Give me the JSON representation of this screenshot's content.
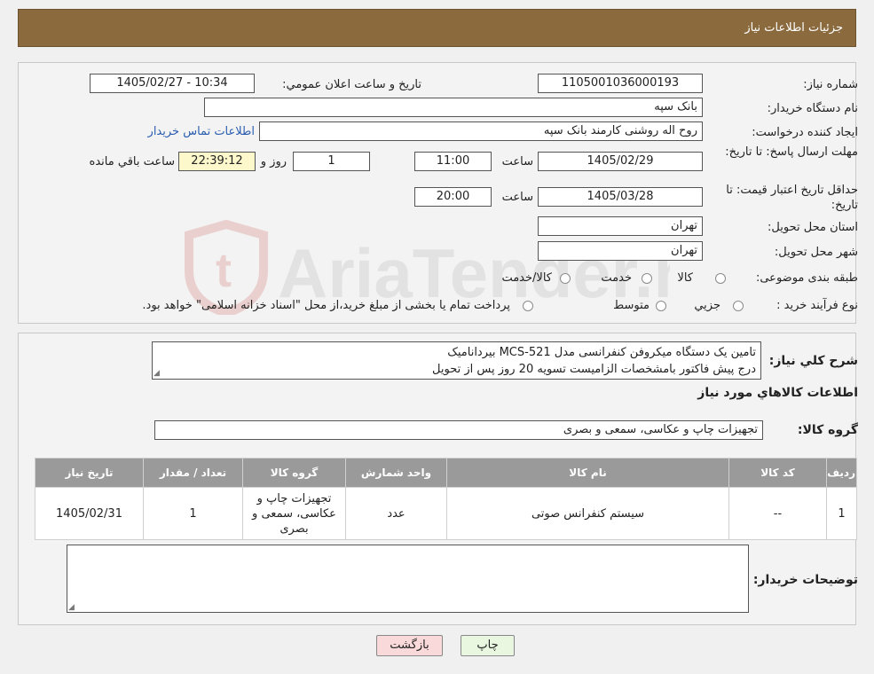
{
  "header": {
    "title": "جزئیات اطلاعات نیاز"
  },
  "watermark": {
    "text": "AriaTender.neT"
  },
  "form": {
    "need_number": {
      "label": "شماره نیاز:",
      "value": "1105001036000193"
    },
    "announce_datetime": {
      "label": "تاریخ و ساعت اعلان عمومي:",
      "value": "1405/02/27 - 10:34"
    },
    "buyer_org": {
      "label": "نام دستگاه خریدار:",
      "value": "بانک سپه"
    },
    "requester": {
      "label": "ایجاد کننده درخواست:",
      "value": "روح اله روشنی کارمند بانک سپه"
    },
    "contact_link": "اطلاعات تماس خریدار",
    "deadline": {
      "label": "مهلت ارسال پاسخ: تا تاریخ:",
      "date": "1405/02/29",
      "time_label": "ساعت",
      "time": "11:00",
      "days": "1",
      "days_label": "روز و",
      "remaining": "22:39:12",
      "remaining_label": "ساعت باقي مانده"
    },
    "price_validity": {
      "label": "حداقل تاریخ اعتبار قیمت: تا تاریخ:",
      "date": "1405/03/28",
      "time_label": "ساعت",
      "time": "20:00"
    },
    "province": {
      "label": "استان محل تحویل:",
      "value": "تهران"
    },
    "city": {
      "label": "شهر محل تحویل:",
      "value": "تهران"
    },
    "category": {
      "label": "طبقه بندی موضوعی:",
      "options": [
        "کالا",
        "خدمت",
        "کالا/خدمت"
      ]
    },
    "purchase_process": {
      "label": "نوع فرآیند خرید :",
      "options": [
        "جزیي",
        "متوسط"
      ],
      "note": "پرداخت تمام یا بخشی از مبلغ خرید،از محل \"اسناد خزانه اسلامی\" خواهد بود."
    }
  },
  "description": {
    "label": "شرح کلي نیاز:",
    "line1": "تامین یک دستگاه میکروفن کنفرانسی مدل MCS-521 بیردانامیک",
    "line2": "درج پیش فاکتور بامشخصات الزامیست تسویه 20 روز پس از تحویل"
  },
  "goods_section_title": "اطلاعات کالاهاي مورد نیاز",
  "goods_group": {
    "label": "گروه کالا:",
    "value": "تجهیزات چاپ و عکاسی، سمعی و بصری"
  },
  "table": {
    "headers": [
      "ردیف",
      "کد کالا",
      "نام کالا",
      "واحد شمارش",
      "گروه کالا",
      "تعداد / مقدار",
      "تاریخ نیاز"
    ],
    "row": {
      "index": "1",
      "code": "--",
      "name": "سیستم کنفرانس صوتی",
      "unit": "عدد",
      "group": "تجهیزات چاپ و عکاسی، سمعی و بصری",
      "qty": "1",
      "date": "1405/02/31"
    }
  },
  "buyer_notes": {
    "label": "توضیحات خریدار:",
    "value": ""
  },
  "buttons": {
    "print": "چاپ",
    "back": "بازگشت"
  },
  "colors": {
    "header_bg": "#8b6a3e",
    "table_header_bg": "#9a9a9a",
    "back_button_bg": "#f9d9d9"
  }
}
